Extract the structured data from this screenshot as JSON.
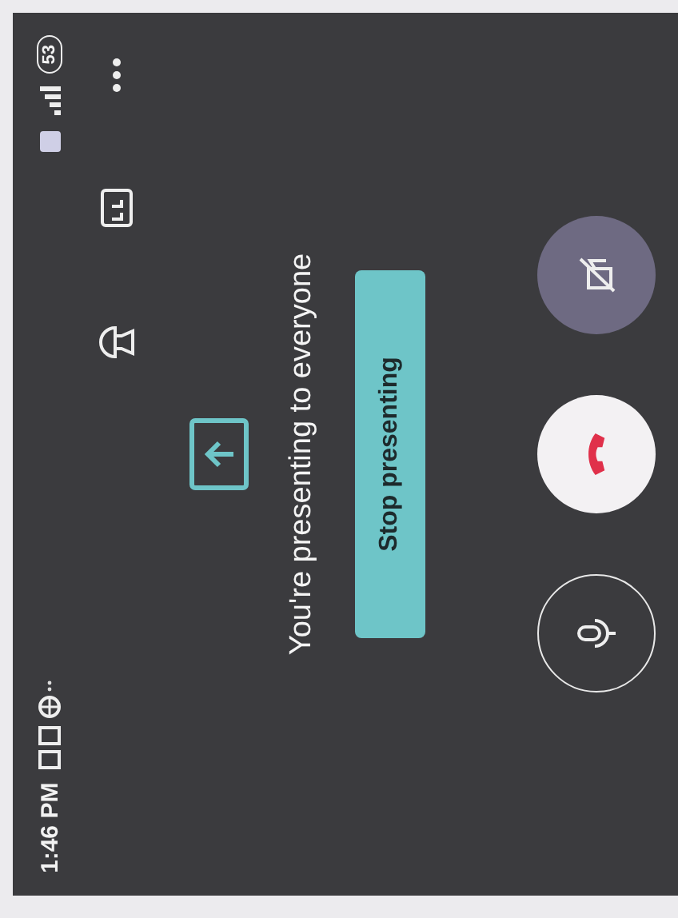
{
  "status_bar": {
    "time": "1:46 PM",
    "battery": "53"
  },
  "presenting": {
    "message": "You're presenting to everyone",
    "button": "Stop presenting"
  }
}
